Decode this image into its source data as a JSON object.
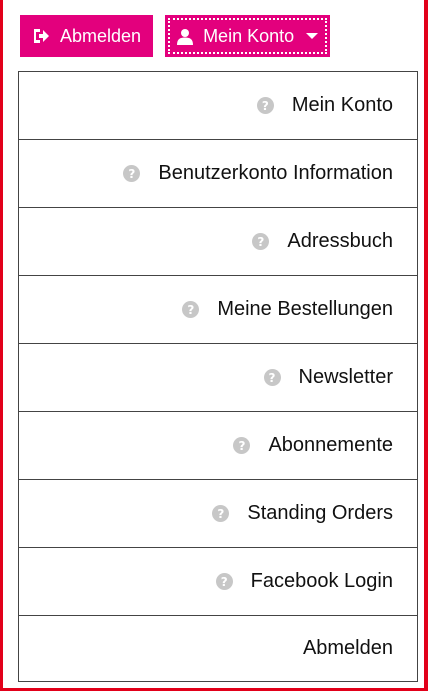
{
  "accent_color": "#e3007d",
  "frame_color": "#e2001a",
  "header": {
    "logout_button": {
      "label": "Abmelden",
      "icon": "sign-out-icon"
    },
    "account_button": {
      "label": "Mein Konto",
      "icon": "user-icon",
      "caret_icon": "caret-down-icon"
    }
  },
  "dropdown": {
    "items": [
      {
        "label": "Mein Konto",
        "icon": "question-circle-icon",
        "glyph": "?"
      },
      {
        "label": "Benutzerkonto Information",
        "icon": "question-circle-icon",
        "glyph": "?"
      },
      {
        "label": "Adressbuch",
        "icon": "question-circle-icon",
        "glyph": "?"
      },
      {
        "label": "Meine Bestellungen",
        "icon": "question-circle-icon",
        "glyph": "?"
      },
      {
        "label": "Newsletter",
        "icon": "question-circle-icon",
        "glyph": "?"
      },
      {
        "label": "Abonnemente",
        "icon": "question-circle-icon",
        "glyph": "?"
      },
      {
        "label": "Standing Orders",
        "icon": "question-circle-icon",
        "glyph": "?"
      },
      {
        "label": "Facebook Login",
        "icon": "question-circle-icon",
        "glyph": "?"
      },
      {
        "label": "Abmelden"
      }
    ]
  }
}
